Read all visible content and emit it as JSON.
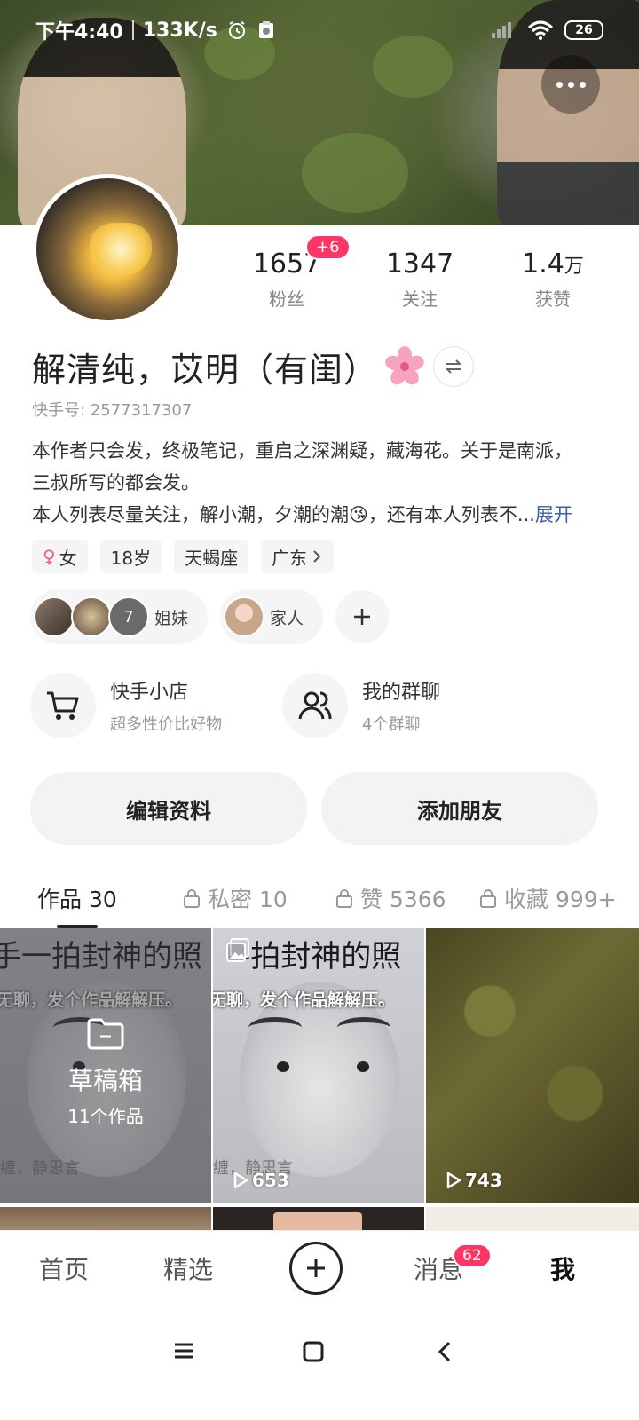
{
  "status_bar": {
    "time": "下午4:40",
    "net_speed": "133K/s",
    "battery": "26"
  },
  "profile": {
    "name": "解清纯，苡明（有闺）",
    "kuaishou_id": "快手号: 2577317307",
    "bio_line1": "本作者只会发，终极笔记，重启之深渊疑，藏海花。关于是南派，",
    "bio_line2": "三叔所写的都会发。",
    "bio_line3": "本人列表尽量关注，解小潮，夕潮的潮😘，还有本人列表不...",
    "bio_expand": "展开"
  },
  "stats": {
    "fans_value": "1657",
    "fans_label": "粉丝",
    "fans_badge": "+6",
    "following_value": "1347",
    "following_label": "关注",
    "likes_value": "1.4",
    "likes_unit": "万",
    "likes_label": "获赞"
  },
  "tags": {
    "gender": "女",
    "age": "18岁",
    "zodiac": "天蝎座",
    "location": "广东"
  },
  "groups": {
    "sisters_count": "7",
    "sisters_label": "姐妹",
    "family_label": "家人"
  },
  "services": {
    "shop_title": "快手小店",
    "shop_sub": "超多性价比好物",
    "chat_title": "我的群聊",
    "chat_sub": "4个群聊"
  },
  "actions": {
    "edit": "编辑资料",
    "add_friend": "添加朋友"
  },
  "tabs": {
    "works": "作品 30",
    "private": "私密 10",
    "liked": "赞 5366",
    "favorites": "收藏 999+"
  },
  "grid": {
    "caption_big": "手一拍封神的照",
    "caption_big2": "-拍封神的照",
    "caption_small": "无聊，发个作品解解压。",
    "caption_small2": "无聊，发个作品解解压。",
    "faint1": "缠，静思言",
    "faint2": "缠，静思言",
    "draft_title": "草稿箱",
    "draft_count": "11个作品",
    "plays2": "653",
    "plays3": "743"
  },
  "bottom_nav": {
    "home": "首页",
    "featured": "精选",
    "messages": "消息",
    "messages_badge": "62",
    "me": "我"
  },
  "colors": {
    "accent_badge": "#fe3666",
    "expand_link": "#3e5da8"
  }
}
